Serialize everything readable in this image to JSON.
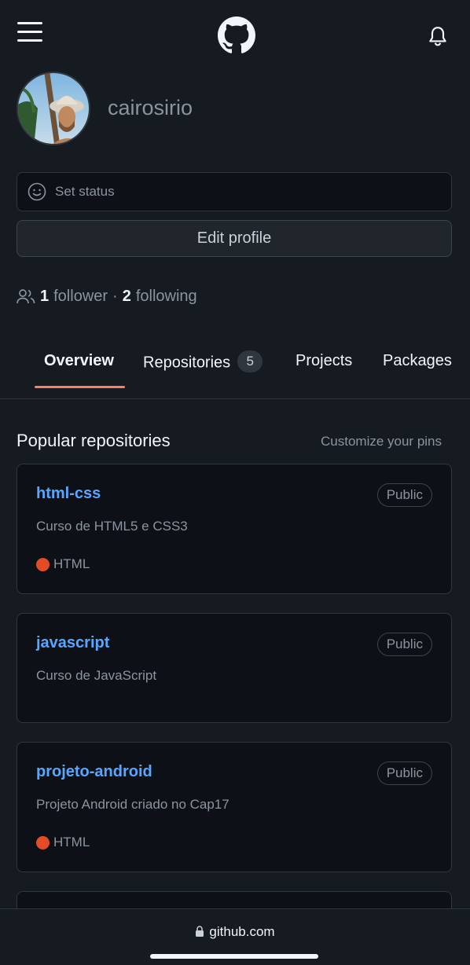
{
  "header": {
    "menu_icon": "hamburger-icon",
    "logo_icon": "github-logo-icon",
    "notification_icon": "bell-icon"
  },
  "profile": {
    "username": "cairosirio",
    "status_placeholder": "Set status",
    "edit_profile_label": "Edit profile",
    "followers_count": "1",
    "followers_label": "follower",
    "separator": "·",
    "following_count": "2",
    "following_label": "following"
  },
  "tabs": [
    {
      "label": "Overview",
      "active": true
    },
    {
      "label": "Repositories",
      "count": "5"
    },
    {
      "label": "Projects"
    },
    {
      "label": "Packages"
    }
  ],
  "popular": {
    "title": "Popular repositories",
    "customize_label": "Customize your pins"
  },
  "repos": [
    {
      "name": "html-css",
      "visibility": "Public",
      "description": "Curso de HTML5 e CSS3",
      "language": "HTML",
      "language_color": "#e34c26"
    },
    {
      "name": "javascript",
      "visibility": "Public",
      "description": "Curso de JavaScript"
    },
    {
      "name": "projeto-android",
      "visibility": "Public",
      "description": "Projeto Android criado no Cap17",
      "language": "HTML",
      "language_color": "#e34c26"
    }
  ],
  "browser": {
    "url": "github.com",
    "lock_icon": "lock-icon"
  },
  "colors": {
    "background": "#161b22",
    "link": "#58a6ff",
    "tab_underline": "#f78166"
  }
}
